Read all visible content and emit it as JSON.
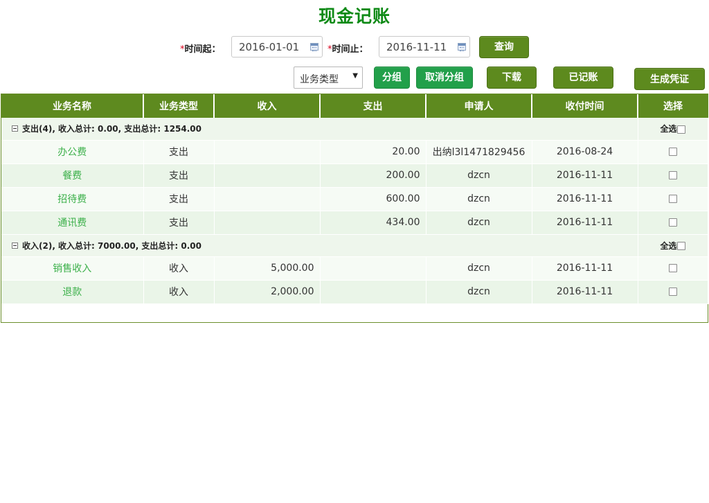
{
  "title": "现金记账",
  "filters": {
    "start_label": "时间起：",
    "start_value": "2016-01-01",
    "end_label": "时间止：",
    "end_value": "2016-11-11",
    "required_mark": "*",
    "query_label": "查询",
    "type_select_value": "业务类型"
  },
  "toolbar": {
    "group_label": "分组",
    "ungroup_label": "取消分组",
    "download_label": "下载",
    "posted_label": "已记账",
    "voucher_label": "生成凭证"
  },
  "table": {
    "columns": [
      "业务名称",
      "业务类型",
      "收入",
      "支出",
      "申请人",
      "收付时间",
      "选择"
    ],
    "select_all_label": "全选",
    "groups": [
      {
        "summary": "支出(4), 收入总计: 0.00, 支出总计: 1254.00",
        "rows": [
          {
            "name": "办公费",
            "type": "支出",
            "income": "",
            "expense": "20.00",
            "applicant": "出纳l3l1471829456",
            "date": "2016-08-24"
          },
          {
            "name": "餐费",
            "type": "支出",
            "income": "",
            "expense": "200.00",
            "applicant": "dzcn",
            "date": "2016-11-11"
          },
          {
            "name": "招待费",
            "type": "支出",
            "income": "",
            "expense": "600.00",
            "applicant": "dzcn",
            "date": "2016-11-11"
          },
          {
            "name": "通讯费",
            "type": "支出",
            "income": "",
            "expense": "434.00",
            "applicant": "dzcn",
            "date": "2016-11-11"
          }
        ]
      },
      {
        "summary": "收入(2), 收入总计: 7000.00, 支出总计: 0.00",
        "rows": [
          {
            "name": "销售收入",
            "type": "收入",
            "income": "5,000.00",
            "expense": "",
            "applicant": "dzcn",
            "date": "2016-11-11"
          },
          {
            "name": "退款",
            "type": "收入",
            "income": "2,000.00",
            "expense": "",
            "applicant": "dzcn",
            "date": "2016-11-11"
          }
        ]
      }
    ]
  },
  "colors": {
    "title": "#0e8a16",
    "header_bg": "#5e8a1f",
    "button_bg": "#5d8a1e",
    "button_alt_bg": "#22a04a",
    "link_text": "#3cb04a"
  }
}
